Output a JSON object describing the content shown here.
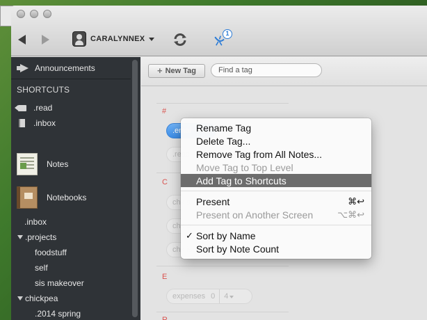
{
  "toolbar": {
    "account_name": "CARALYNNEX",
    "activity_badge": "1"
  },
  "sidebar": {
    "announcements": "Announcements",
    "shortcuts_header": "SHORTCUTS",
    "shortcuts": [
      ".read",
      ".inbox"
    ],
    "notes": "Notes",
    "notebooks": "Notebooks",
    "tree": [
      ".inbox",
      ".projects",
      "foodstuff",
      "self",
      "sis makeover",
      "chickpea",
      ".2014 spring"
    ]
  },
  "main": {
    "new_tag_label": "New Tag",
    "find_placeholder": "Find a tag",
    "sections": [
      "#",
      "C",
      "E",
      "R"
    ],
    "tags": {
      "email": ".emai",
      "read": ".read",
      "chk_a": "chk a",
      "chk_o": "chk o",
      "chk_is": "chk is",
      "expenses": "expenses",
      "expenses_count": "0",
      "expenses_menu": "4"
    }
  },
  "context_menu": {
    "items": [
      "Rename Tag",
      "Delete Tag...",
      "Remove Tag from All Notes...",
      "Move Tag to Top Level",
      "Add Tag to Shortcuts",
      "Present",
      "Present on Another Screen",
      "Sort by Name",
      "Sort by Note Count"
    ],
    "shortcuts": {
      "present": "⌘↩",
      "present_other": "⌥⌘↩"
    },
    "checkmark": "✓"
  }
}
